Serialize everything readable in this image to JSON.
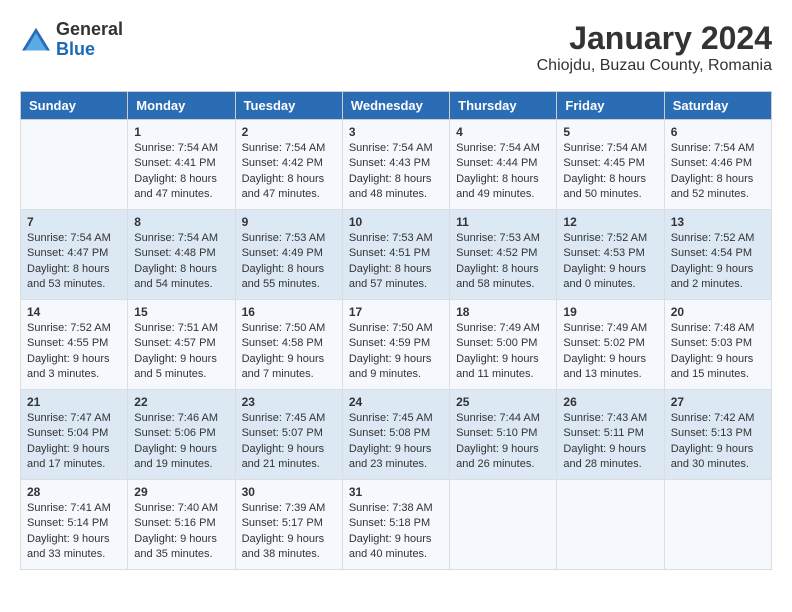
{
  "header": {
    "logo": {
      "general": "General",
      "blue": "Blue"
    },
    "title": "January 2024",
    "subtitle": "Chiojdu, Buzau County, Romania"
  },
  "weekdays": [
    "Sunday",
    "Monday",
    "Tuesday",
    "Wednesday",
    "Thursday",
    "Friday",
    "Saturday"
  ],
  "weeks": [
    [
      {
        "day": "",
        "sunrise": "",
        "sunset": "",
        "daylight": ""
      },
      {
        "day": "1",
        "sunrise": "Sunrise: 7:54 AM",
        "sunset": "Sunset: 4:41 PM",
        "daylight": "Daylight: 8 hours and 47 minutes."
      },
      {
        "day": "2",
        "sunrise": "Sunrise: 7:54 AM",
        "sunset": "Sunset: 4:42 PM",
        "daylight": "Daylight: 8 hours and 47 minutes."
      },
      {
        "day": "3",
        "sunrise": "Sunrise: 7:54 AM",
        "sunset": "Sunset: 4:43 PM",
        "daylight": "Daylight: 8 hours and 48 minutes."
      },
      {
        "day": "4",
        "sunrise": "Sunrise: 7:54 AM",
        "sunset": "Sunset: 4:44 PM",
        "daylight": "Daylight: 8 hours and 49 minutes."
      },
      {
        "day": "5",
        "sunrise": "Sunrise: 7:54 AM",
        "sunset": "Sunset: 4:45 PM",
        "daylight": "Daylight: 8 hours and 50 minutes."
      },
      {
        "day": "6",
        "sunrise": "Sunrise: 7:54 AM",
        "sunset": "Sunset: 4:46 PM",
        "daylight": "Daylight: 8 hours and 52 minutes."
      }
    ],
    [
      {
        "day": "7",
        "sunrise": "Sunrise: 7:54 AM",
        "sunset": "Sunset: 4:47 PM",
        "daylight": "Daylight: 8 hours and 53 minutes."
      },
      {
        "day": "8",
        "sunrise": "Sunrise: 7:54 AM",
        "sunset": "Sunset: 4:48 PM",
        "daylight": "Daylight: 8 hours and 54 minutes."
      },
      {
        "day": "9",
        "sunrise": "Sunrise: 7:53 AM",
        "sunset": "Sunset: 4:49 PM",
        "daylight": "Daylight: 8 hours and 55 minutes."
      },
      {
        "day": "10",
        "sunrise": "Sunrise: 7:53 AM",
        "sunset": "Sunset: 4:51 PM",
        "daylight": "Daylight: 8 hours and 57 minutes."
      },
      {
        "day": "11",
        "sunrise": "Sunrise: 7:53 AM",
        "sunset": "Sunset: 4:52 PM",
        "daylight": "Daylight: 8 hours and 58 minutes."
      },
      {
        "day": "12",
        "sunrise": "Sunrise: 7:52 AM",
        "sunset": "Sunset: 4:53 PM",
        "daylight": "Daylight: 9 hours and 0 minutes."
      },
      {
        "day": "13",
        "sunrise": "Sunrise: 7:52 AM",
        "sunset": "Sunset: 4:54 PM",
        "daylight": "Daylight: 9 hours and 2 minutes."
      }
    ],
    [
      {
        "day": "14",
        "sunrise": "Sunrise: 7:52 AM",
        "sunset": "Sunset: 4:55 PM",
        "daylight": "Daylight: 9 hours and 3 minutes."
      },
      {
        "day": "15",
        "sunrise": "Sunrise: 7:51 AM",
        "sunset": "Sunset: 4:57 PM",
        "daylight": "Daylight: 9 hours and 5 minutes."
      },
      {
        "day": "16",
        "sunrise": "Sunrise: 7:50 AM",
        "sunset": "Sunset: 4:58 PM",
        "daylight": "Daylight: 9 hours and 7 minutes."
      },
      {
        "day": "17",
        "sunrise": "Sunrise: 7:50 AM",
        "sunset": "Sunset: 4:59 PM",
        "daylight": "Daylight: 9 hours and 9 minutes."
      },
      {
        "day": "18",
        "sunrise": "Sunrise: 7:49 AM",
        "sunset": "Sunset: 5:00 PM",
        "daylight": "Daylight: 9 hours and 11 minutes."
      },
      {
        "day": "19",
        "sunrise": "Sunrise: 7:49 AM",
        "sunset": "Sunset: 5:02 PM",
        "daylight": "Daylight: 9 hours and 13 minutes."
      },
      {
        "day": "20",
        "sunrise": "Sunrise: 7:48 AM",
        "sunset": "Sunset: 5:03 PM",
        "daylight": "Daylight: 9 hours and 15 minutes."
      }
    ],
    [
      {
        "day": "21",
        "sunrise": "Sunrise: 7:47 AM",
        "sunset": "Sunset: 5:04 PM",
        "daylight": "Daylight: 9 hours and 17 minutes."
      },
      {
        "day": "22",
        "sunrise": "Sunrise: 7:46 AM",
        "sunset": "Sunset: 5:06 PM",
        "daylight": "Daylight: 9 hours and 19 minutes."
      },
      {
        "day": "23",
        "sunrise": "Sunrise: 7:45 AM",
        "sunset": "Sunset: 5:07 PM",
        "daylight": "Daylight: 9 hours and 21 minutes."
      },
      {
        "day": "24",
        "sunrise": "Sunrise: 7:45 AM",
        "sunset": "Sunset: 5:08 PM",
        "daylight": "Daylight: 9 hours and 23 minutes."
      },
      {
        "day": "25",
        "sunrise": "Sunrise: 7:44 AM",
        "sunset": "Sunset: 5:10 PM",
        "daylight": "Daylight: 9 hours and 26 minutes."
      },
      {
        "day": "26",
        "sunrise": "Sunrise: 7:43 AM",
        "sunset": "Sunset: 5:11 PM",
        "daylight": "Daylight: 9 hours and 28 minutes."
      },
      {
        "day": "27",
        "sunrise": "Sunrise: 7:42 AM",
        "sunset": "Sunset: 5:13 PM",
        "daylight": "Daylight: 9 hours and 30 minutes."
      }
    ],
    [
      {
        "day": "28",
        "sunrise": "Sunrise: 7:41 AM",
        "sunset": "Sunset: 5:14 PM",
        "daylight": "Daylight: 9 hours and 33 minutes."
      },
      {
        "day": "29",
        "sunrise": "Sunrise: 7:40 AM",
        "sunset": "Sunset: 5:16 PM",
        "daylight": "Daylight: 9 hours and 35 minutes."
      },
      {
        "day": "30",
        "sunrise": "Sunrise: 7:39 AM",
        "sunset": "Sunset: 5:17 PM",
        "daylight": "Daylight: 9 hours and 38 minutes."
      },
      {
        "day": "31",
        "sunrise": "Sunrise: 7:38 AM",
        "sunset": "Sunset: 5:18 PM",
        "daylight": "Daylight: 9 hours and 40 minutes."
      },
      {
        "day": "",
        "sunrise": "",
        "sunset": "",
        "daylight": ""
      },
      {
        "day": "",
        "sunrise": "",
        "sunset": "",
        "daylight": ""
      },
      {
        "day": "",
        "sunrise": "",
        "sunset": "",
        "daylight": ""
      }
    ]
  ]
}
